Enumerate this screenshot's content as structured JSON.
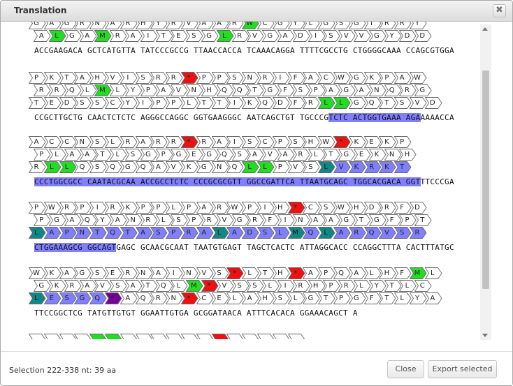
{
  "dialog": {
    "title": "Translation",
    "close_symbol": "✖"
  },
  "status": "Selection 222-338 nt: 39 aa",
  "buttons": {
    "close": "Close",
    "export": "Export selected"
  },
  "colors": {
    "start_codon": "#22dd22",
    "stop_codon": "#ee1111",
    "selection": "#8080ff",
    "selected_start": "#118888",
    "selected_stop": "#770099"
  },
  "blocks": [
    {
      "frames": [
        {
          "offset": 0,
          "aas": [
            "G",
            "A",
            "G",
            "R",
            "N",
            "A",
            "R",
            "H",
            "Y",
            "R",
            "V",
            "A",
            "A",
            "R",
            "W",
            "C",
            "G",
            "Y",
            "L",
            "G",
            "S",
            "G",
            "I",
            "R",
            "R",
            "Y"
          ],
          "marks": {
            "14": "g"
          }
        },
        {
          "offset": 1,
          "aas": [
            "A",
            "L",
            "G",
            "A",
            "M",
            "R",
            "A",
            "I",
            "T",
            "E",
            "S",
            "G",
            "L",
            "R",
            "V",
            "G",
            "A",
            "D",
            "I",
            "S",
            "V",
            "V",
            "G",
            "Y",
            "D",
            "D"
          ],
          "marks": {
            "1": "g",
            "4": "g",
            "12": "g"
          }
        }
      ],
      "dna": [
        "ACCGAAGACA",
        "GCTCATGTTA",
        "TATCCCGCCG",
        "TTAACCACCA",
        "TCAAACAGGA",
        "TTTTCGCCTG",
        "CTGGGGCAAA",
        "CCAGCGTGGA"
      ],
      "hl_start": -1,
      "hl_end": -1
    },
    {
      "frames": [
        {
          "offset": 0,
          "aas": [
            "P",
            "K",
            "T",
            "A",
            "H",
            "V",
            "I",
            "S",
            "R",
            "R",
            "*",
            "P",
            "P",
            "S",
            "N",
            "R",
            "I",
            "F",
            "A",
            "C",
            "W",
            "G",
            "K",
            "P",
            "A",
            "W"
          ],
          "marks": {
            "10": "r"
          }
        },
        {
          "offset": 1,
          "aas": [
            "R",
            "R",
            "Q",
            "L",
            "M",
            "L",
            "Y",
            "P",
            "A",
            "V",
            "N",
            "H",
            "Q",
            "Q",
            "T",
            "G",
            "F",
            "S",
            "P",
            "A",
            "G",
            "A",
            "N",
            "Q",
            "R",
            "G"
          ],
          "marks": {
            "4": "g"
          }
        },
        {
          "offset": 0,
          "aas": [
            "T",
            "E",
            "D",
            "S",
            "S",
            "C",
            "Y",
            "I",
            "P",
            "P",
            "L",
            "T",
            "T",
            "I",
            "K",
            "Q",
            "D",
            "F",
            "R",
            "L",
            "L",
            "G",
            "Q",
            "T",
            "S",
            "V",
            "D"
          ],
          "marks": {
            "19": "g",
            "20": "g"
          }
        }
      ],
      "dna": [
        "CCGCTTGCTG",
        "CAACTCTCTC",
        "AGGGCCAGGC",
        "GGTGAAGGGC",
        "AATCAGCTGT",
        "TGCCCGTCTC",
        "ACTGGTGAAA",
        "AGAAAAACCA"
      ],
      "hl_start": 61,
      "hl_end": 80
    },
    {
      "frames": [
        {
          "offset": 0,
          "aas": [
            "A",
            "C",
            "C",
            "N",
            "S",
            "L",
            "R",
            "A",
            "R",
            "R",
            "*",
            "R",
            "A",
            "I",
            "S",
            "C",
            "P",
            "S",
            "H",
            "W",
            "*",
            "K",
            "E",
            "K",
            "P"
          ],
          "marks": {
            "10": "r",
            "20": "r"
          }
        },
        {
          "offset": 1,
          "aas": [
            "P",
            "L",
            "A",
            "A",
            "T",
            "L",
            "S",
            "G",
            "P",
            "G",
            "E",
            "G",
            "Q",
            "S",
            "A",
            "V",
            "A",
            "R",
            "L",
            "T",
            "G",
            "E",
            "K",
            "N",
            "H"
          ],
          "marks": {}
        },
        {
          "offset": 0,
          "aas": [
            "R",
            "L",
            "L",
            "Q",
            "S",
            "Q",
            "G",
            "Q",
            "A",
            "V",
            "K",
            "G",
            "N",
            "Q",
            "L",
            "L",
            "P",
            "V",
            "S",
            "L",
            "V",
            "K",
            "R",
            "K",
            "T"
          ],
          "marks": {
            "1": "g",
            "2": "g",
            "14": "g",
            "15": "g",
            "19": "s"
          },
          "hl_from": 19
        }
      ],
      "dna": [
        "CCCTGGCGCC",
        "CAATACGCAA",
        "ACCGCCTCTC",
        "CCCGCGCGTT",
        "GGCCGATTCA",
        "TTAATGCAGC",
        "TGGCACGACA",
        "GGTTTCCCGA"
      ],
      "hl_start": 0,
      "hl_end": 80
    },
    {
      "frames": [
        {
          "offset": 0,
          "aas": [
            "P",
            "W",
            "R",
            "P",
            "I",
            "R",
            "K",
            "P",
            "P",
            "L",
            "P",
            "A",
            "R",
            "W",
            "P",
            "I",
            "H",
            "*",
            "C",
            "S",
            "W",
            "H",
            "D",
            "R",
            "F",
            "D"
          ],
          "marks": {
            "17": "r"
          }
        },
        {
          "offset": 1,
          "aas": [
            "P",
            "G",
            "A",
            "Q",
            "Y",
            "A",
            "N",
            "R",
            "L",
            "S",
            "P",
            "R",
            "V",
            "G",
            "R",
            "F",
            "I",
            "N",
            "A",
            "A",
            "G",
            "T",
            "G",
            "F",
            "P",
            "T"
          ],
          "marks": {}
        },
        {
          "offset": 0,
          "aas": [
            "L",
            "A",
            "P",
            "N",
            "T",
            "Q",
            "T",
            "A",
            "S",
            "P",
            "R",
            "A",
            "L",
            "A",
            "D",
            "S",
            "L",
            "M",
            "Q",
            "L",
            "A",
            "R",
            "Q",
            "V",
            "S",
            "R"
          ],
          "marks": {
            "0": "s",
            "12": "s",
            "17": "s",
            "19": "s"
          },
          "hl_from": 0
        }
      ],
      "dna": [
        "CTGGAAAGCG",
        "GGCAGTGAGC",
        "GCAACGCAAT",
        "TAATGTGAGT",
        "TAGCTCACTC",
        "ATTAGGCACC",
        "CCAGGCTTTA",
        "CACTTTATGC"
      ],
      "hl_start": 0,
      "hl_end": 17
    },
    {
      "frames": [
        {
          "offset": 0,
          "aas": [
            "W",
            "K",
            "A",
            "G",
            "S",
            "E",
            "R",
            "N",
            "A",
            "I",
            "N",
            "V",
            "S",
            "*",
            "L",
            "T",
            "H",
            "*",
            "A",
            "P",
            "Q",
            "A",
            "L",
            "H",
            "F",
            "M",
            "L"
          ],
          "marks": {
            "13": "r",
            "17": "r",
            "25": "g"
          }
        },
        {
          "offset": 1,
          "aas": [
            "G",
            "K",
            "R",
            "A",
            "V",
            "S",
            "A",
            "T",
            "Q",
            "L",
            "M",
            "*",
            "V",
            "S",
            "S",
            "L",
            "I",
            "R",
            "H",
            "P",
            "R",
            "L",
            "Y",
            "T",
            "L",
            "C"
          ],
          "marks": {
            "10": "g",
            "11": "r"
          }
        },
        {
          "offset": 0,
          "aas": [
            "L",
            "E",
            "S",
            "G",
            "Q",
            "*",
            "A",
            "Q",
            "R",
            "N",
            "*",
            "C",
            "E",
            "L",
            "A",
            "H",
            "S",
            "L",
            "G",
            "T",
            "P",
            "G",
            "F",
            "T",
            "L",
            "Y",
            "A"
          ],
          "marks": {
            "0": "s",
            "5": "p",
            "10": "r"
          },
          "hl_to": 5
        }
      ],
      "dna": [
        "TTCCGGCTCG",
        "TATGTTGTGT",
        "GGAATTGTGA",
        "GCGGATAACA",
        "ATTTCACACA",
        "GGAAACAGCT",
        "A"
      ],
      "hl_start": -1,
      "hl_end": -1
    }
  ]
}
